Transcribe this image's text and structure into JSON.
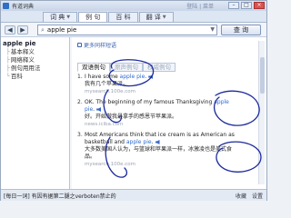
{
  "window": {
    "title": "有道词典",
    "right_text": "登陆 | 菜单"
  },
  "tabs": [
    {
      "label": "词 典",
      "active": false
    },
    {
      "label": "例 句",
      "active": true
    },
    {
      "label": "百 科",
      "active": false
    },
    {
      "label": "翻 译",
      "active": false
    }
  ],
  "search": {
    "value": "apple pie",
    "button_label": "查 询"
  },
  "sidebar": {
    "head": "apple pie",
    "items": [
      "基本释义",
      "网络释义",
      "例句用用法",
      "百科"
    ]
  },
  "main": {
    "more_link": "更多同样短语",
    "subtabs": [
      {
        "label": "双语例句",
        "active": true
      },
      {
        "label": "原声例句",
        "active": false
      },
      {
        "label": "权威例句",
        "active": false
      }
    ],
    "examples": [
      {
        "num": "1.",
        "en_pre": "I have some ",
        "en_hl": "apple pie",
        "en_post": ".",
        "zh": "我有几个苹果派。",
        "src": "mysearch.100e.com"
      },
      {
        "num": "2.",
        "en_pre": "OK. The beginning of my famous Thanksgiving ",
        "en_hl": "apple pie",
        "en_post": ".",
        "zh": "好。开始做我最拿手的感恩节苹果派。",
        "src": "news.iciba.com"
      },
      {
        "num": "3.",
        "en_pre": "Most Americans think that ice cream is as American as basketball and ",
        "en_hl": "apple pie",
        "en_post": ".",
        "zh": "大多数美国人认为，与篮球和苹果派一样，冰激凌也是美式食品。",
        "src": "mysearch.100e.com"
      }
    ]
  },
  "status": {
    "message": "[每日一词] 有因有据第二腿之verboten禁止的",
    "right_items": [
      "收藏",
      "设置"
    ]
  },
  "colors": {
    "accent": "#2d6bd3",
    "scribble": "#1c2a9c"
  }
}
